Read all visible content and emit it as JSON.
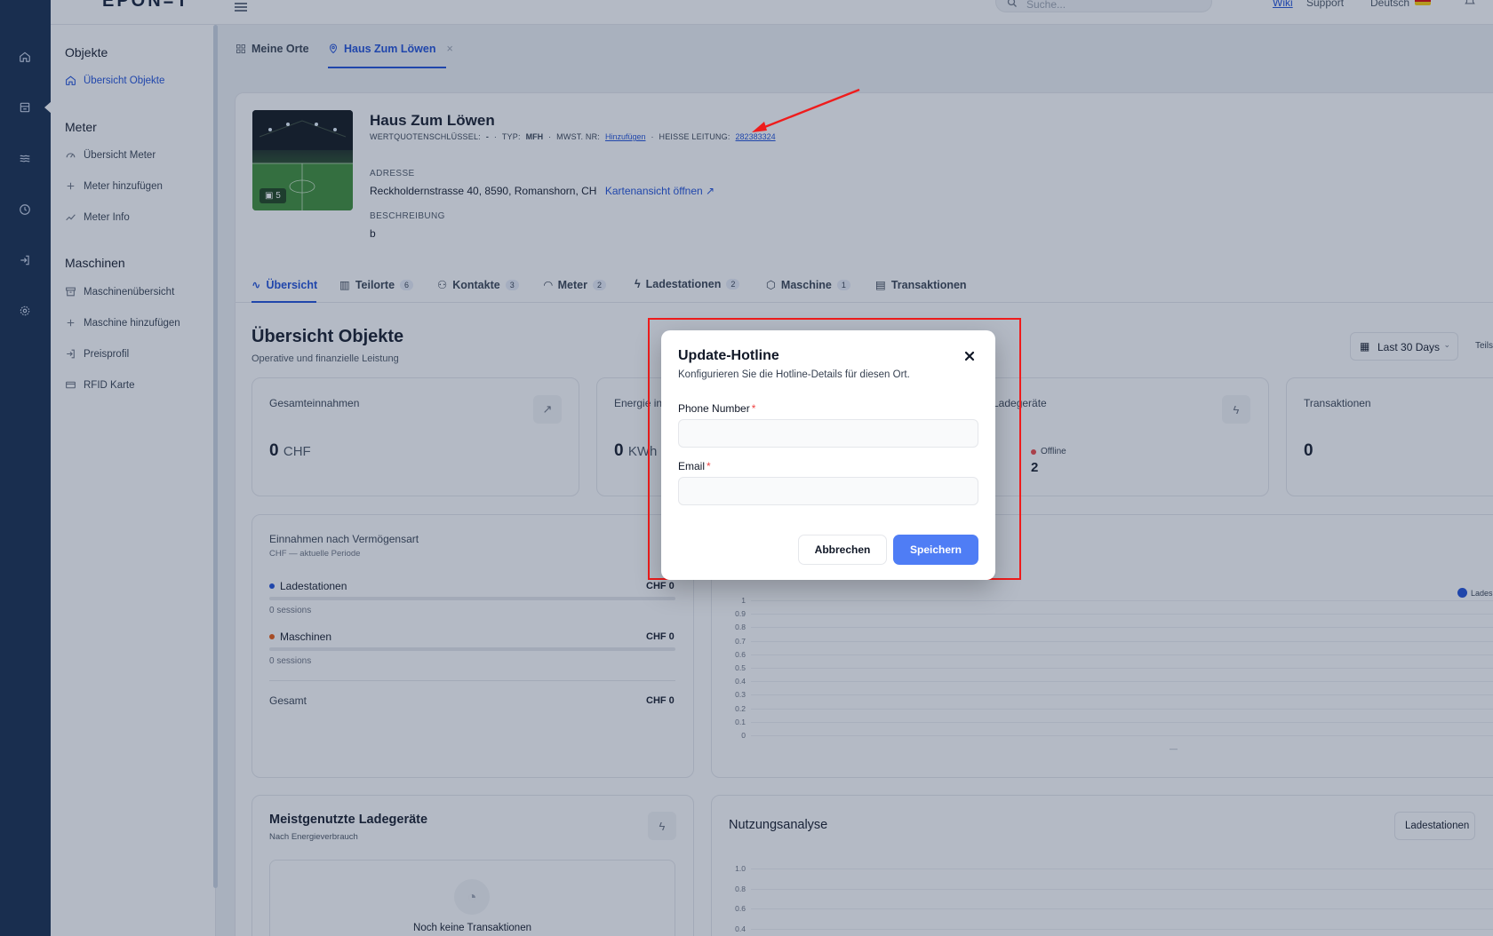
{
  "topbar": {
    "logo": "EPON=T",
    "search_placeholder": "Suche...",
    "wiki": "Wiki",
    "support": "Support",
    "language": "Deutsch"
  },
  "sidebar": {
    "sections": [
      {
        "title": "Objekte",
        "items": [
          {
            "label": "Übersicht Objekte",
            "icon": "home-icon",
            "active": true
          }
        ]
      },
      {
        "title": "Meter",
        "items": [
          {
            "label": "Übersicht Meter",
            "icon": "gauge-icon"
          },
          {
            "label": "Meter hinzufügen",
            "icon": "plus-icon"
          },
          {
            "label": "Meter Info",
            "icon": "trend-icon"
          }
        ]
      },
      {
        "title": "Maschinen",
        "items": [
          {
            "label": "Maschinenübersicht",
            "icon": "archive-icon"
          },
          {
            "label": "Maschine hinzufügen",
            "icon": "plus-icon"
          },
          {
            "label": "Preisprofil",
            "icon": "login-icon"
          },
          {
            "label": "RFID Karte",
            "icon": "card-icon"
          }
        ]
      }
    ]
  },
  "page_tabs": [
    {
      "label": "Meine Orte",
      "icon": "grid-icon"
    },
    {
      "label": "Haus Zum Löwen",
      "icon": "pin-icon",
      "active": true
    }
  ],
  "property": {
    "photo_count": "5",
    "name": "Haus Zum Löwen",
    "wertquote_label": "WERTQUOTENSCHLÜSSEL:",
    "wertquote_value": "-",
    "typ_label": "TYP:",
    "typ_value": "MFH",
    "mwst_label": "MWST. NR:",
    "mwst_link": "Hinzufügen",
    "hotline_label": "HEISSE LEITUNG:",
    "hotline_value": "282383324",
    "address_label": "ADRESSE",
    "address": "Reckholdernstrasse 40, 8590, Romanshorn, CH",
    "map_link": "Kartenansicht öffnen",
    "description_label": "BESCHREIBUNG",
    "description": "b"
  },
  "content_tabs": [
    {
      "label": "Übersicht",
      "count": "",
      "active": true
    },
    {
      "label": "Teilorte",
      "count": "6"
    },
    {
      "label": "Kontakte",
      "count": "3"
    },
    {
      "label": "Meter",
      "count": "2"
    },
    {
      "label": "Ladestationen",
      "count": "2"
    },
    {
      "label": "Maschine",
      "count": "1"
    },
    {
      "label": "Transaktionen",
      "count": ""
    }
  ],
  "overview": {
    "title": "Übersicht Objekte",
    "subtitle": "Operative und finanzielle Leistung",
    "date_range": "Last 30 Days",
    "teil_label": "Teils"
  },
  "kpis": {
    "revenue_label": "Gesamteinnahmen",
    "revenue_value": "0",
    "revenue_unit": "CHF",
    "energy_label": "Energie in",
    "energy_value": "0",
    "energy_unit": "KWh",
    "chargers_label": "Ladegeräte",
    "offline_label": "Offline",
    "offline_value": "2",
    "transactions_label": "Transaktionen",
    "transactions_value": "0"
  },
  "revenue_breakdown": {
    "title": "Einnahmen nach Vermögensart",
    "subtitle": "CHF — aktuelle Periode",
    "rows": [
      {
        "label": "Ladestationen",
        "amount": "CHF 0",
        "sessions": "0 sessions",
        "color": "#1d4ed8"
      },
      {
        "label": "Maschinen",
        "amount": "CHF 0",
        "sessions": "0 sessions",
        "color": "#ea580c"
      }
    ],
    "total_label": "Gesamt",
    "total_amount": "CHF 0"
  },
  "chart1": {
    "legend": "Lades",
    "x_label": "—",
    "y_ticks": [
      "1",
      "0.9",
      "0.8",
      "0.7",
      "0.6",
      "0.5",
      "0.4",
      "0.3",
      "0.2",
      "0.1",
      "0"
    ]
  },
  "top_chargers": {
    "title": "Meistgenutzte Ladegeräte",
    "subtitle": "Nach Energieverbrauch",
    "empty": "Noch keine Transaktionen"
  },
  "usage": {
    "title": "Nutzungsanalyse",
    "filter": "Ladestationen",
    "y_ticks": [
      "1.0",
      "0.8",
      "0.6",
      "0.4"
    ]
  },
  "modal": {
    "title": "Update-Hotline",
    "description": "Konfigurieren Sie die Hotline-Details für diesen Ort.",
    "phone_label": "Phone Number",
    "phone_value": "",
    "email_label": "Email",
    "email_value": "",
    "required_mark": "*",
    "cancel": "Abbrechen",
    "save": "Speichern"
  },
  "annotation_color": "#ef1c1c"
}
